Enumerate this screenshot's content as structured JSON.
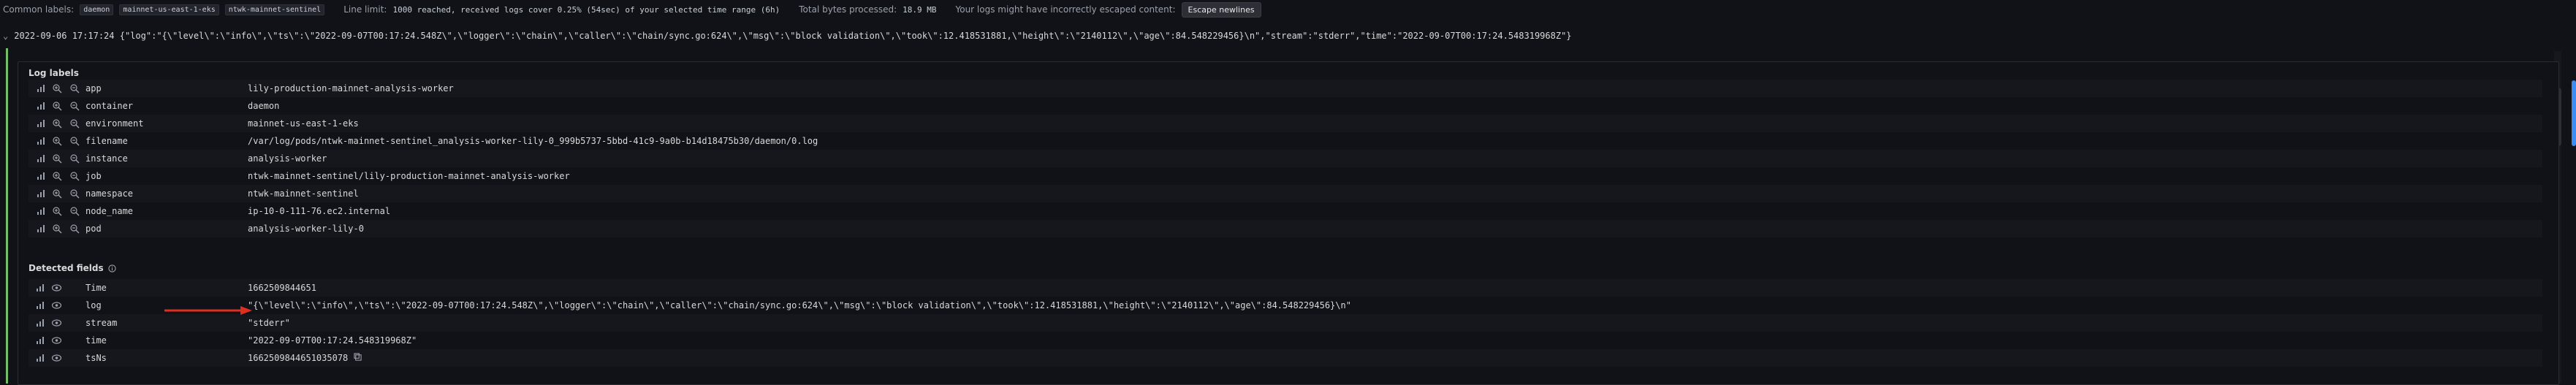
{
  "topbar": {
    "common_labels_label": "Common labels:",
    "common_labels": [
      "daemon",
      "mainnet-us-east-1-eks",
      "ntwk-mainnet-sentinel"
    ],
    "line_limit_label": "Line limit:",
    "line_limit_text": "1000 reached, received logs cover 0.25% (54sec) of your selected time range (6h)",
    "bytes_label": "Total bytes processed:",
    "bytes_value": "18.9 MB",
    "escape_warning": "Your logs might have incorrectly escaped content:",
    "escape_button": "Escape newlines"
  },
  "log_line": {
    "marker": "⌄",
    "timestamp": "2022-09-06 17:17:24",
    "content": "{\"log\":\"{\\\"level\\\":\\\"info\\\",\\\"ts\\\":\\\"2022-09-07T00:17:24.548Z\\\",\\\"logger\\\":\\\"chain\\\",\\\"caller\\\":\\\"chain/sync.go:624\\\",\\\"msg\\\":\\\"block validation\\\",\\\"took\\\":12.418531881,\\\"height\\\":\\\"2140112\\\",\\\"age\\\":84.548229456}\\n\",\"stream\":\"stderr\",\"time\":\"2022-09-07T00:17:24.548319968Z\"}"
  },
  "log_labels": {
    "title": "Log labels",
    "rows": [
      {
        "key": "app",
        "value": "lily-production-mainnet-analysis-worker"
      },
      {
        "key": "container",
        "value": "daemon"
      },
      {
        "key": "environment",
        "value": "mainnet-us-east-1-eks"
      },
      {
        "key": "filename",
        "value": "/var/log/pods/ntwk-mainnet-sentinel_analysis-worker-lily-0_999b5737-5bbd-41c9-9a0b-b14d18475b30/daemon/0.log"
      },
      {
        "key": "instance",
        "value": "analysis-worker"
      },
      {
        "key": "job",
        "value": "ntwk-mainnet-sentinel/lily-production-mainnet-analysis-worker"
      },
      {
        "key": "namespace",
        "value": "ntwk-mainnet-sentinel"
      },
      {
        "key": "node_name",
        "value": "ip-10-0-111-76.ec2.internal"
      },
      {
        "key": "pod",
        "value": "analysis-worker-lily-0"
      }
    ]
  },
  "detected_fields": {
    "title": "Detected fields",
    "rows": [
      {
        "key": "Time",
        "value": "1662509844651"
      },
      {
        "key": "log",
        "value": "\"{\\\"level\\\":\\\"info\\\",\\\"ts\\\":\\\"2022-09-07T00:17:24.548Z\\\",\\\"logger\\\":\\\"chain\\\",\\\"caller\\\":\\\"chain/sync.go:624\\\",\\\"msg\\\":\\\"block validation\\\",\\\"took\\\":12.418531881,\\\"height\\\":\\\"2140112\\\",\\\"age\\\":84.548229456}\\n\""
      },
      {
        "key": "stream",
        "value": "\"stderr\""
      },
      {
        "key": "time",
        "value": "\"2022-09-07T00:17:24.548319968Z\""
      },
      {
        "key": "tsNs",
        "value": "1662509844651035078"
      }
    ]
  },
  "colors": {
    "background": "#111217",
    "accent_green": "#73bf69",
    "arrow_red": "#e02f1f",
    "scroll_accent": "#3a8df5"
  },
  "icons": {
    "stats": "bar-chart-icon",
    "zoom_in": "zoom-in-icon",
    "zoom_out": "zoom-out-icon",
    "eye": "eye-icon",
    "info": "info-icon",
    "copy": "copy-icon"
  }
}
